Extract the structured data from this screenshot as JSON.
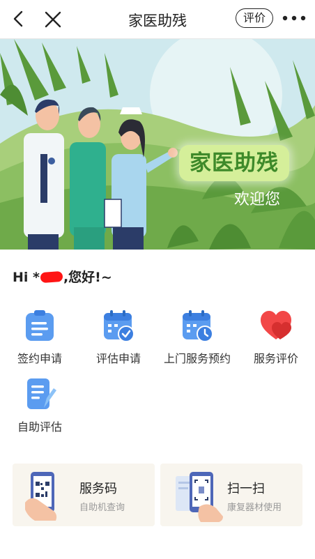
{
  "nav": {
    "title": "家医助残",
    "rate_label": "评价"
  },
  "banner": {
    "title": "家医助残",
    "subtitle": "欢迎您"
  },
  "greeting": {
    "prefix": "Hi *",
    "suffix": ",您好!~"
  },
  "services": [
    {
      "label": "签约申请",
      "icon": "clipboard-icon"
    },
    {
      "label": "评估申请",
      "icon": "calendar-check-icon"
    },
    {
      "label": "上门服务预约",
      "icon": "calendar-clock-icon"
    },
    {
      "label": "服务评价",
      "icon": "heart-icon"
    },
    {
      "label": "自助评估",
      "icon": "document-pen-icon"
    }
  ],
  "cards": [
    {
      "title": "服务码",
      "subtitle": "自助机查询",
      "icon": "qr-code-phone-icon"
    },
    {
      "title": "扫一扫",
      "subtitle": "康复器材使用",
      "icon": "scan-phone-icon"
    }
  ],
  "colors": {
    "accent_blue": "#5b9cf0",
    "heart_red": "#f24747",
    "banner_green": "#7fb45a",
    "card_bg": "#f8f5ee"
  }
}
